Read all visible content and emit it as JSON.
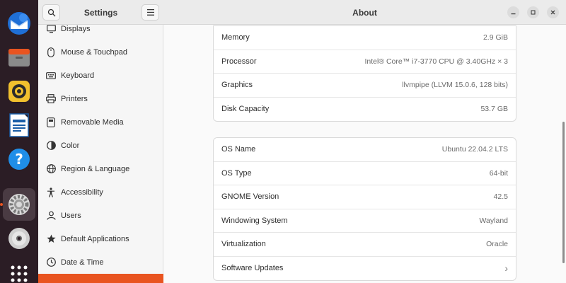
{
  "sidebar": {
    "title": "Settings",
    "items": [
      {
        "label": "Displays",
        "icon": "display-icon"
      },
      {
        "label": "Mouse & Touchpad",
        "icon": "mouse-icon"
      },
      {
        "label": "Keyboard",
        "icon": "keyboard-icon"
      },
      {
        "label": "Printers",
        "icon": "printer-icon"
      },
      {
        "label": "Removable Media",
        "icon": "removable-media-icon"
      },
      {
        "label": "Color",
        "icon": "color-icon"
      },
      {
        "label": "Region & Language",
        "icon": "globe-icon"
      },
      {
        "label": "Accessibility",
        "icon": "accessibility-icon"
      },
      {
        "label": "Users",
        "icon": "users-icon"
      },
      {
        "label": "Default Applications",
        "icon": "star-icon"
      },
      {
        "label": "Date & Time",
        "icon": "clock-icon"
      }
    ]
  },
  "main": {
    "title": "About",
    "hardware": [
      {
        "key": "Memory",
        "value": "2.9 GiB"
      },
      {
        "key": "Processor",
        "value": "Intel® Core™ i7-3770 CPU @ 3.40GHz × 3"
      },
      {
        "key": "Graphics",
        "value": "llvmpipe (LLVM 15.0.6, 128 bits)"
      },
      {
        "key": "Disk Capacity",
        "value": "53.7 GB"
      }
    ],
    "software": [
      {
        "key": "OS Name",
        "value": "Ubuntu 22.04.2 LTS"
      },
      {
        "key": "OS Type",
        "value": "64-bit"
      },
      {
        "key": "GNOME Version",
        "value": "42.5"
      },
      {
        "key": "Windowing System",
        "value": "Wayland"
      },
      {
        "key": "Virtualization",
        "value": "Oracle"
      },
      {
        "key": "Software Updates",
        "value": "›"
      }
    ]
  },
  "colors": {
    "accent": "#e95420",
    "dock": "#2b1d25"
  }
}
